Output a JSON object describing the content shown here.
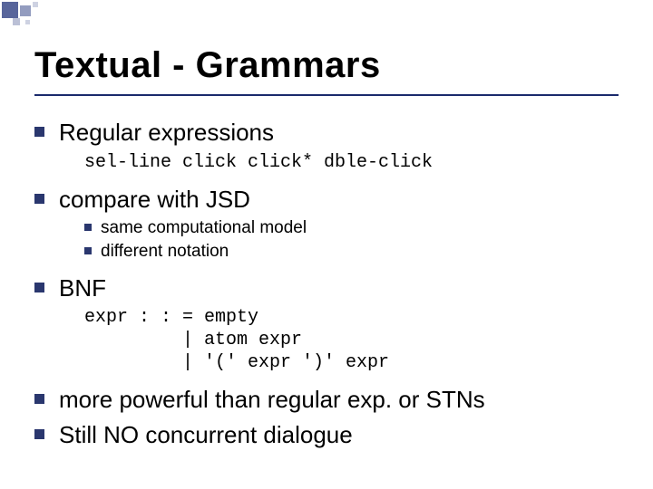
{
  "title": "Textual - Grammars",
  "items": [
    {
      "text": "Regular expressions",
      "code": "sel-line click click* dble-click"
    },
    {
      "text": "compare with JSD",
      "sub": [
        "same computational model",
        "different notation"
      ]
    },
    {
      "text": "BNF",
      "code": "expr : : = empty\n         | atom expr\n         | '(' expr ')' expr"
    },
    {
      "text": "more powerful than regular exp. or STNs"
    },
    {
      "text": "Still NO concurrent dialogue"
    }
  ]
}
